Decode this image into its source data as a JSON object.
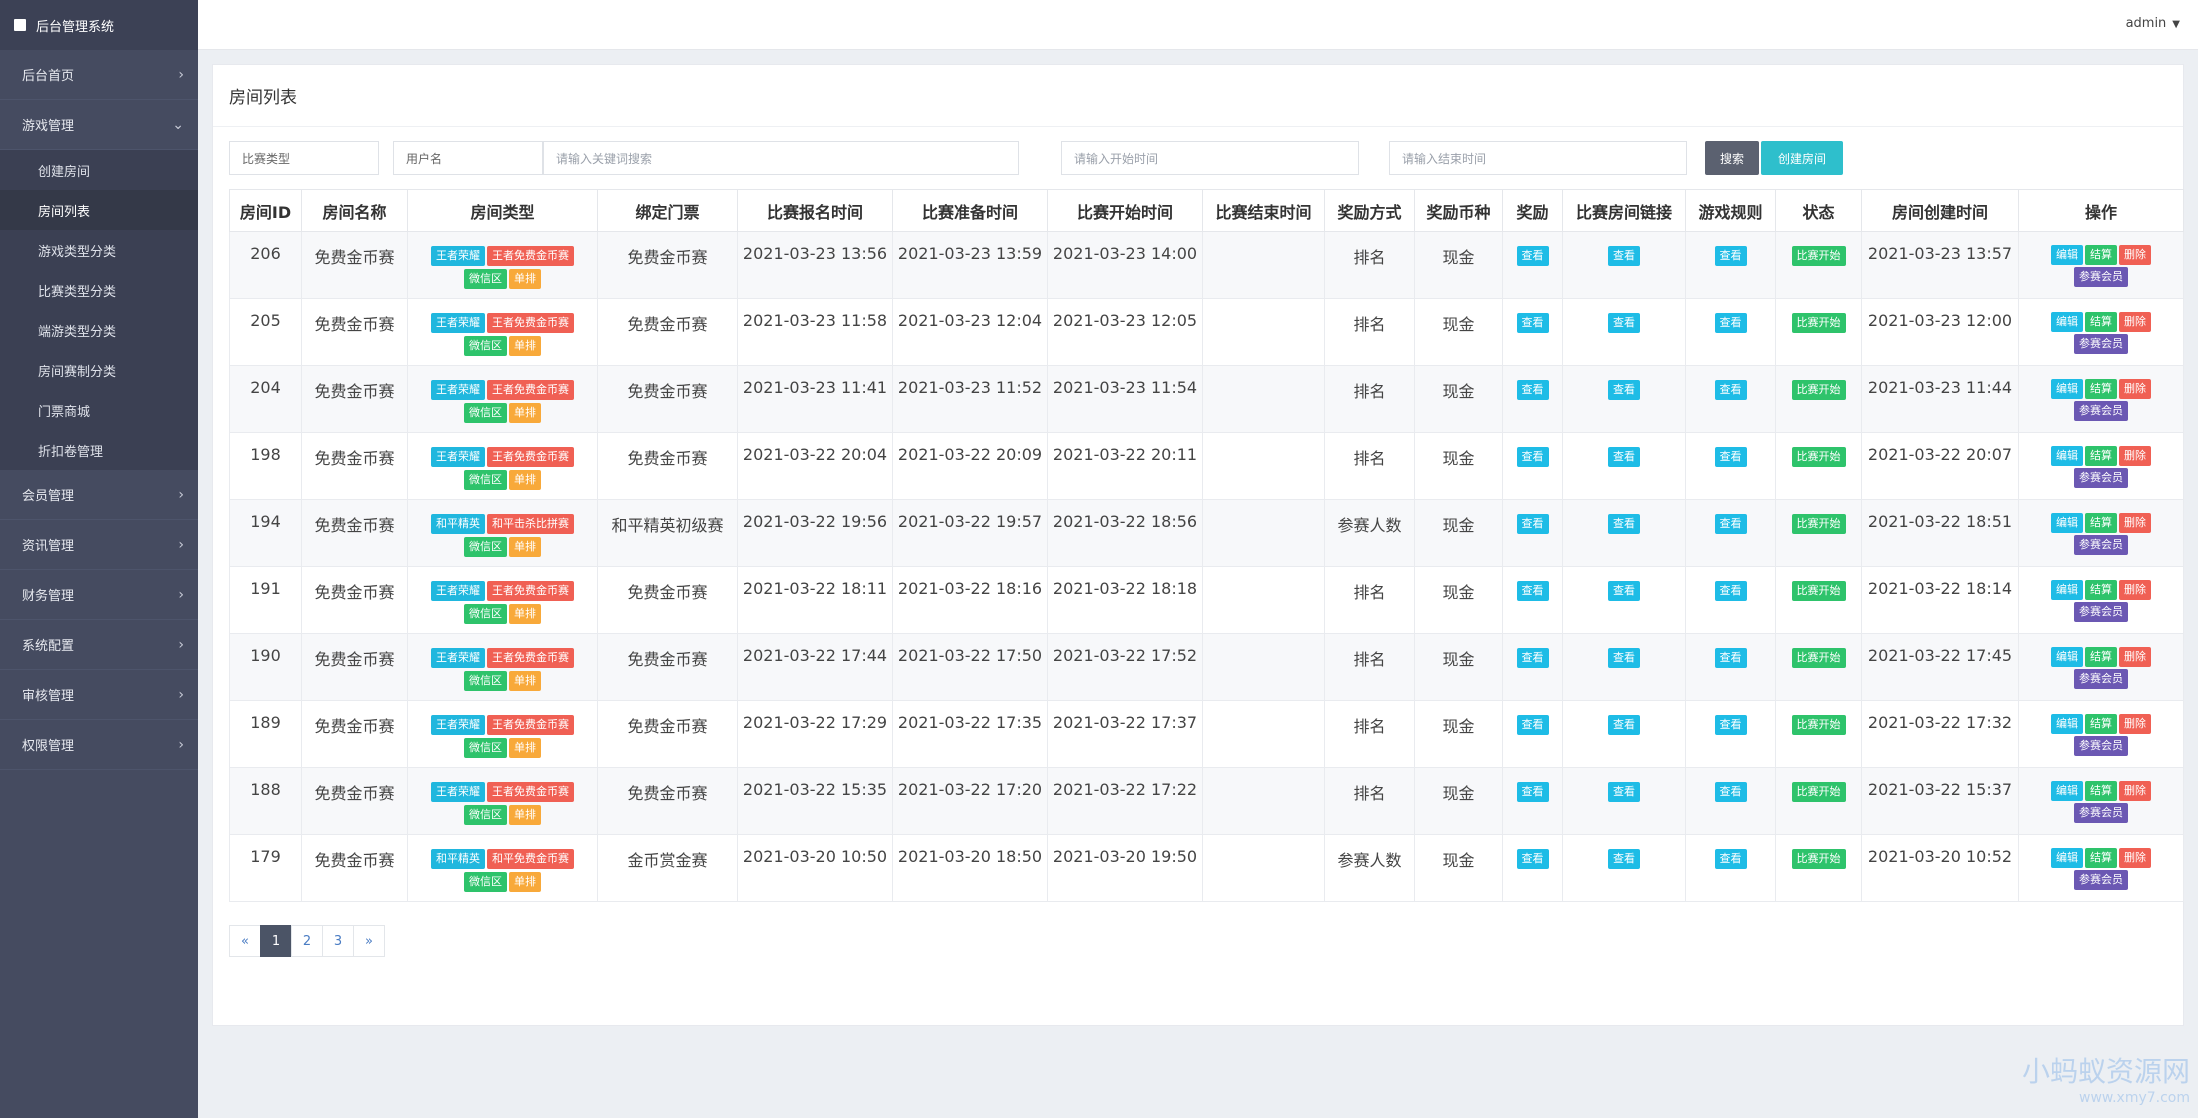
{
  "brand": {
    "title": "后台管理系统",
    "icon": "square-logo-icon"
  },
  "topbar": {
    "user": "admin"
  },
  "sidebar": {
    "items": [
      {
        "label": "后台首页"
      },
      {
        "label": "游戏管理",
        "expanded": true,
        "children": [
          {
            "label": "创建房间"
          },
          {
            "label": "房间列表",
            "active": true
          },
          {
            "label": "游戏类型分类"
          },
          {
            "label": "比赛类型分类"
          },
          {
            "label": "端游类型分类"
          },
          {
            "label": "房间赛制分类"
          },
          {
            "label": "门票商城"
          },
          {
            "label": "折扣卷管理"
          }
        ]
      },
      {
        "label": "会员管理"
      },
      {
        "label": "资讯管理"
      },
      {
        "label": "财务管理"
      },
      {
        "label": "系统配置"
      },
      {
        "label": "审核管理"
      },
      {
        "label": "权限管理"
      }
    ]
  },
  "panel": {
    "title": "房间列表"
  },
  "filters": {
    "match_type": "比赛类型",
    "username": "用户名",
    "keyword_placeholder": "请输入关键词搜索",
    "start_placeholder": "请输入开始时间",
    "end_placeholder": "请输入结束时间",
    "search_label": "搜索",
    "create_label": "创建房间"
  },
  "table": {
    "headers": [
      "房间ID",
      "房间名称",
      "房间类型",
      "绑定门票",
      "比赛报名时间",
      "比赛准备时间",
      "比赛开始时间",
      "比赛结束时间",
      "奖励方式",
      "奖励币种",
      "奖励",
      "比赛房间链接",
      "游戏规则",
      "状态",
      "房间创建时间",
      "操作"
    ],
    "view_label": "查看",
    "status_label": "比赛开始",
    "ops": {
      "edit": "编辑",
      "settle": "结算",
      "delete": "删除",
      "members": "参赛会员"
    },
    "rows": [
      {
        "id": "206",
        "name": "免费金币赛",
        "tags": [
          "王者荣耀",
          "王者免费金币赛",
          "微信区",
          "单排"
        ],
        "ticket": "免费金币赛",
        "signup": "2021-03-23 13:56",
        "prepare": "2021-03-23 13:59",
        "start": "2021-03-23 14:00",
        "end": "",
        "reward_mode": "排名",
        "currency": "现金",
        "created": "2021-03-23 13:57"
      },
      {
        "id": "205",
        "name": "免费金币赛",
        "tags": [
          "王者荣耀",
          "王者免费金币赛",
          "微信区",
          "单排"
        ],
        "ticket": "免费金币赛",
        "signup": "2021-03-23 11:58",
        "prepare": "2021-03-23 12:04",
        "start": "2021-03-23 12:05",
        "end": "",
        "reward_mode": "排名",
        "currency": "现金",
        "created": "2021-03-23 12:00"
      },
      {
        "id": "204",
        "name": "免费金币赛",
        "tags": [
          "王者荣耀",
          "王者免费金币赛",
          "微信区",
          "单排"
        ],
        "ticket": "免费金币赛",
        "signup": "2021-03-23 11:41",
        "prepare": "2021-03-23 11:52",
        "start": "2021-03-23 11:54",
        "end": "",
        "reward_mode": "排名",
        "currency": "现金",
        "created": "2021-03-23 11:44"
      },
      {
        "id": "198",
        "name": "免费金币赛",
        "tags": [
          "王者荣耀",
          "王者免费金币赛",
          "微信区",
          "单排"
        ],
        "ticket": "免费金币赛",
        "signup": "2021-03-22 20:04",
        "prepare": "2021-03-22 20:09",
        "start": "2021-03-22 20:11",
        "end": "",
        "reward_mode": "排名",
        "currency": "现金",
        "created": "2021-03-22 20:07"
      },
      {
        "id": "194",
        "name": "免费金币赛",
        "tags": [
          "和平精英",
          "和平击杀比拼赛",
          "微信区",
          "单排"
        ],
        "ticket": "和平精英初级赛",
        "signup": "2021-03-22 19:56",
        "prepare": "2021-03-22 19:57",
        "start": "2021-03-22 18:56",
        "end": "",
        "reward_mode": "参赛人数",
        "currency": "现金",
        "created": "2021-03-22 18:51"
      },
      {
        "id": "191",
        "name": "免费金币赛",
        "tags": [
          "王者荣耀",
          "王者免费金币赛",
          "微信区",
          "单排"
        ],
        "ticket": "免费金币赛",
        "signup": "2021-03-22 18:11",
        "prepare": "2021-03-22 18:16",
        "start": "2021-03-22 18:18",
        "end": "",
        "reward_mode": "排名",
        "currency": "现金",
        "created": "2021-03-22 18:14"
      },
      {
        "id": "190",
        "name": "免费金币赛",
        "tags": [
          "王者荣耀",
          "王者免费金币赛",
          "微信区",
          "单排"
        ],
        "ticket": "免费金币赛",
        "signup": "2021-03-22 17:44",
        "prepare": "2021-03-22 17:50",
        "start": "2021-03-22 17:52",
        "end": "",
        "reward_mode": "排名",
        "currency": "现金",
        "created": "2021-03-22 17:45"
      },
      {
        "id": "189",
        "name": "免费金币赛",
        "tags": [
          "王者荣耀",
          "王者免费金币赛",
          "微信区",
          "单排"
        ],
        "ticket": "免费金币赛",
        "signup": "2021-03-22 17:29",
        "prepare": "2021-03-22 17:35",
        "start": "2021-03-22 17:37",
        "end": "",
        "reward_mode": "排名",
        "currency": "现金",
        "created": "2021-03-22 17:32"
      },
      {
        "id": "188",
        "name": "免费金币赛",
        "tags": [
          "王者荣耀",
          "王者免费金币赛",
          "微信区",
          "单排"
        ],
        "ticket": "免费金币赛",
        "signup": "2021-03-22 15:35",
        "prepare": "2021-03-22 17:20",
        "start": "2021-03-22 17:22",
        "end": "",
        "reward_mode": "排名",
        "currency": "现金",
        "created": "2021-03-22 15:37"
      },
      {
        "id": "179",
        "name": "免费金币赛",
        "tags": [
          "和平精英",
          "和平免费金币赛",
          "微信区",
          "单排"
        ],
        "ticket": "金币赏金赛",
        "signup": "2021-03-20 10:50",
        "prepare": "2021-03-20 18:50",
        "start": "2021-03-20 19:50",
        "end": "",
        "reward_mode": "参赛人数",
        "currency": "现金",
        "created": "2021-03-20 10:52"
      }
    ]
  },
  "pagination": {
    "prev": "«",
    "pages": [
      "1",
      "2",
      "3"
    ],
    "next": "»",
    "current": "1"
  },
  "watermark": {
    "title": "小蚂蚁资源网",
    "url": "www.xmy7.com"
  },
  "colors": {
    "sidebar_bg": "#454b60",
    "tag_blue": "#20b7de",
    "tag_red": "#f06054",
    "tag_green": "#2ec36b",
    "tag_orange": "#f8a93a",
    "tag_purple": "#6b58b3",
    "btn_create": "#2ebfcc",
    "btn_search": "#5b6170"
  }
}
